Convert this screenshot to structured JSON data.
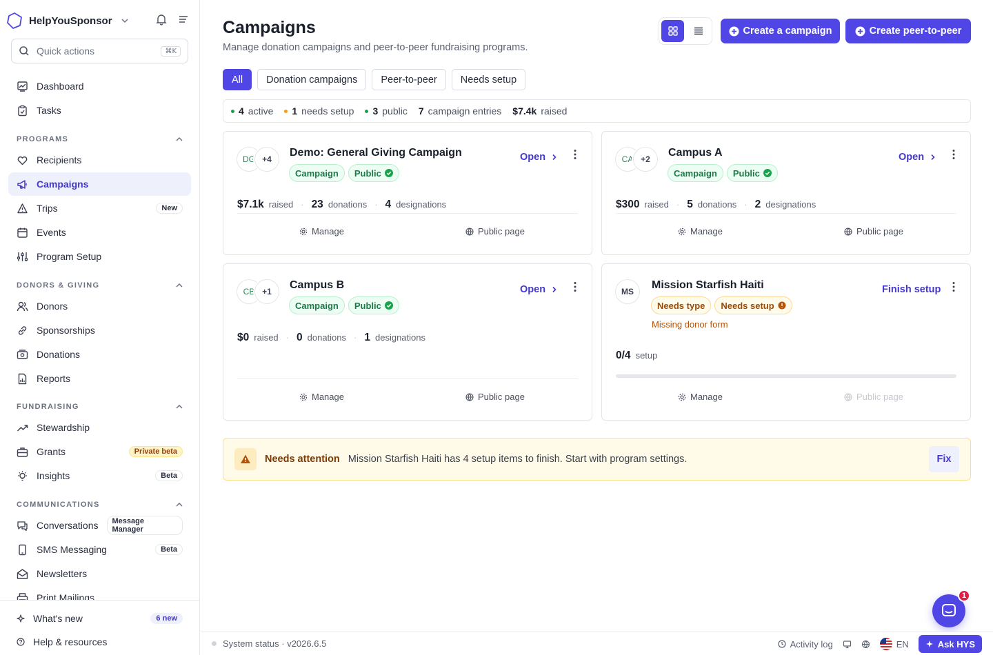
{
  "app": {
    "name": "HelpYouSponsor"
  },
  "quick_actions": {
    "placeholder": "Quick actions",
    "shortcut": "⌘K"
  },
  "nav_top": [
    {
      "label": "Dashboard",
      "icon": "dashboard-icon"
    },
    {
      "label": "Tasks",
      "icon": "clipboard-icon"
    }
  ],
  "sections": {
    "programs": "PROGRAMS",
    "donors_giving": "DONORS & GIVING",
    "fundraising": "FUNDRAISING",
    "communications": "COMMUNICATIONS"
  },
  "nav_programs": [
    {
      "label": "Recipients"
    },
    {
      "label": "Campaigns",
      "active": true
    },
    {
      "label": "Trips",
      "badge": "New"
    },
    {
      "label": "Events"
    },
    {
      "label": "Program Setup"
    }
  ],
  "nav_donors": [
    {
      "label": "Donors"
    },
    {
      "label": "Sponsorships"
    },
    {
      "label": "Donations"
    },
    {
      "label": "Reports"
    }
  ],
  "nav_fundraising": [
    {
      "label": "Stewardship"
    },
    {
      "label": "Grants",
      "badge": "Private beta"
    },
    {
      "label": "Insights",
      "badge": "Beta"
    }
  ],
  "nav_communications": [
    {
      "label": "Conversations",
      "badge": "Message Manager"
    },
    {
      "label": "SMS Messaging",
      "badge": "Beta"
    },
    {
      "label": "Newsletters"
    },
    {
      "label": "Print Mailings"
    }
  ],
  "footer_nav": {
    "whats_new": "What's new",
    "whats_new_badge": "6 new",
    "help": "Help & resources"
  },
  "page": {
    "title": "Campaigns",
    "subtitle": "Manage donation campaigns and peer-to-peer fundraising programs.",
    "create_campaign": "Create a campaign",
    "create_p2p": "Create peer-to-peer"
  },
  "filters": [
    "All",
    "Donation campaigns",
    "Peer-to-peer",
    "Needs setup"
  ],
  "stats": {
    "active_count": "4",
    "active_label": "active",
    "setup_count": "1",
    "setup_label": "needs setup",
    "public_count": "3",
    "public_label": "public",
    "entries_count": "7",
    "entries_label": "campaign entries",
    "raised_amount": "$7.4k",
    "raised_label": "raised"
  },
  "labels": {
    "raised": "raised",
    "donations": "donations",
    "designations": "designations",
    "open": "Open",
    "manage": "Manage",
    "public_page": "Public page",
    "campaign_badge": "Campaign",
    "public_badge": "Public",
    "finish_setup": "Finish setup",
    "setup": "setup"
  },
  "campaigns": [
    {
      "title": "Demo: General Giving Campaign",
      "initials": "DG",
      "extra": "+4",
      "raised": "$7.1k",
      "donations": "23",
      "designations": "4"
    },
    {
      "title": "Campus A",
      "initials": "CA",
      "extra": "+2",
      "raised": "$300",
      "donations": "5",
      "designations": "2"
    },
    {
      "title": "Campus B",
      "initials": "CB",
      "extra": "+1",
      "raised": "$0",
      "donations": "0",
      "designations": "1"
    },
    {
      "title": "Mission Starfish Haiti",
      "initials": "MS",
      "badge_type": "Needs type",
      "badge_setup": "Needs setup",
      "warning": "Missing donor form",
      "setup_progress": "0/4",
      "setup_fraction": 0
    }
  ],
  "attention": {
    "title": "Needs attention",
    "message": "Mission Starfish Haiti has 4 setup items to finish. Start with program settings.",
    "fix": "Fix"
  },
  "statusbar": {
    "system": "System status · v2026.6.5",
    "activity": "Activity log",
    "lang": "EN",
    "ask": "Ask HYS"
  },
  "chat": {
    "unread": "1"
  },
  "colors": {
    "accent": "#4f46e5",
    "success": "#16a34a",
    "warning": "#d97706"
  }
}
